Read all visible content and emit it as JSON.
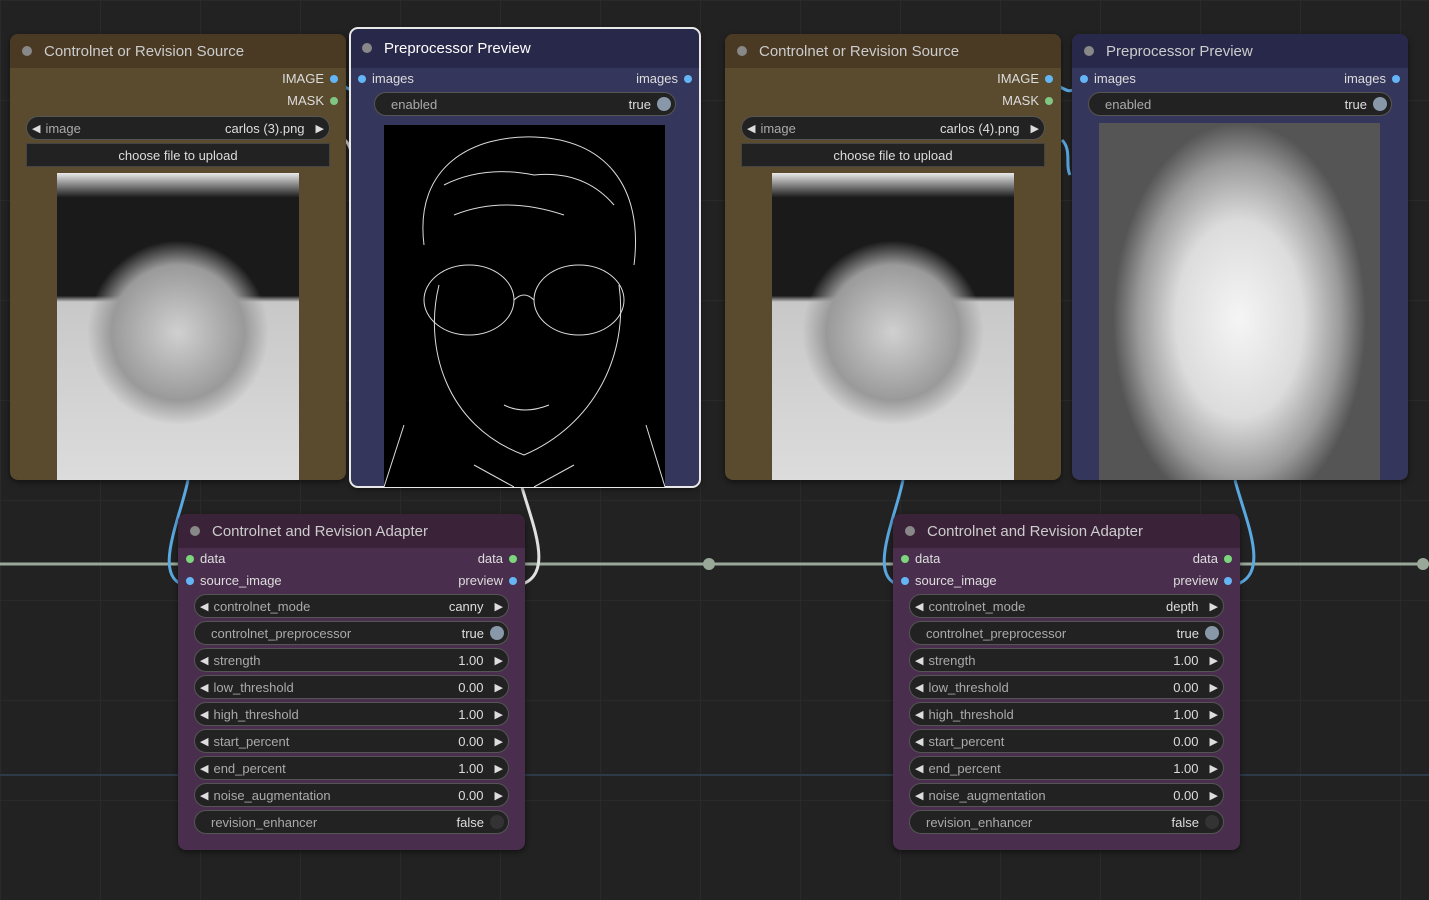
{
  "colors": {
    "image_pin": "#64b5f6",
    "mask_pin": "#81c784",
    "data_pin": "#7cd67c",
    "link_blue": "#5aa8e0",
    "link_gray": "#9aa89a"
  },
  "source_nodes": [
    {
      "title": "Controlnet or Revision Source",
      "out_image": "IMAGE",
      "out_mask": "MASK",
      "image_label": "image",
      "image_value": "carlos (3).png",
      "upload_label": "choose file to upload",
      "image_desc": "photo"
    },
    {
      "title": "Controlnet or Revision Source",
      "out_image": "IMAGE",
      "out_mask": "MASK",
      "image_label": "image",
      "image_value": "carlos (4).png",
      "upload_label": "choose file to upload",
      "image_desc": "photo"
    }
  ],
  "preview_nodes": [
    {
      "title": "Preprocessor Preview",
      "in_label": "images",
      "out_label": "images",
      "enabled_label": "enabled",
      "enabled_value": "true",
      "image_desc": "canny"
    },
    {
      "title": "Preprocessor Preview",
      "in_label": "images",
      "out_label": "images",
      "enabled_label": "enabled",
      "enabled_value": "true",
      "image_desc": "depth"
    }
  ],
  "adapter_nodes": [
    {
      "title": "Controlnet and Revision Adapter",
      "in_data": "data",
      "out_data": "data",
      "in_source": "source_image",
      "out_preview": "preview",
      "widgets": [
        {
          "name": "controlnet_mode",
          "value": "canny",
          "type": "combo"
        },
        {
          "name": "controlnet_preprocessor",
          "value": "true",
          "type": "toggle",
          "on": true
        },
        {
          "name": "strength",
          "value": "1.00",
          "type": "number"
        },
        {
          "name": "low_threshold",
          "value": "0.00",
          "type": "number"
        },
        {
          "name": "high_threshold",
          "value": "1.00",
          "type": "number"
        },
        {
          "name": "start_percent",
          "value": "0.00",
          "type": "number"
        },
        {
          "name": "end_percent",
          "value": "1.00",
          "type": "number"
        },
        {
          "name": "noise_augmentation",
          "value": "0.00",
          "type": "number"
        },
        {
          "name": "revision_enhancer",
          "value": "false",
          "type": "toggle",
          "on": false
        }
      ]
    },
    {
      "title": "Controlnet and Revision Adapter",
      "in_data": "data",
      "out_data": "data",
      "in_source": "source_image",
      "out_preview": "preview",
      "widgets": [
        {
          "name": "controlnet_mode",
          "value": "depth",
          "type": "combo"
        },
        {
          "name": "controlnet_preprocessor",
          "value": "true",
          "type": "toggle",
          "on": true
        },
        {
          "name": "strength",
          "value": "1.00",
          "type": "number"
        },
        {
          "name": "low_threshold",
          "value": "0.00",
          "type": "number"
        },
        {
          "name": "high_threshold",
          "value": "1.00",
          "type": "number"
        },
        {
          "name": "start_percent",
          "value": "0.00",
          "type": "number"
        },
        {
          "name": "end_percent",
          "value": "1.00",
          "type": "number"
        },
        {
          "name": "noise_augmentation",
          "value": "0.00",
          "type": "number"
        },
        {
          "name": "revision_enhancer",
          "value": "false",
          "type": "toggle",
          "on": false
        }
      ]
    }
  ]
}
